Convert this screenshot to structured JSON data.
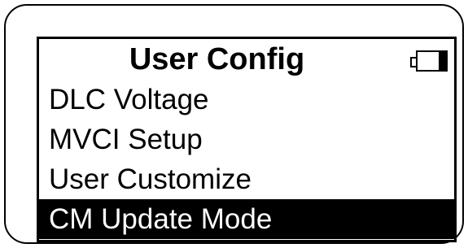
{
  "screen": {
    "title": "User Config",
    "battery_icon": "battery-icon",
    "battery_level": 0.25
  },
  "menu": {
    "items": [
      {
        "label": "DLC Voltage",
        "selected": false
      },
      {
        "label": "MVCI Setup",
        "selected": false
      },
      {
        "label": "User Customize",
        "selected": false
      },
      {
        "label": "CM Update Mode",
        "selected": true
      }
    ]
  },
  "colors": {
    "foreground": "#000000",
    "background": "#ffffff",
    "highlight": "#000000",
    "highlight_text": "#ffffff"
  }
}
